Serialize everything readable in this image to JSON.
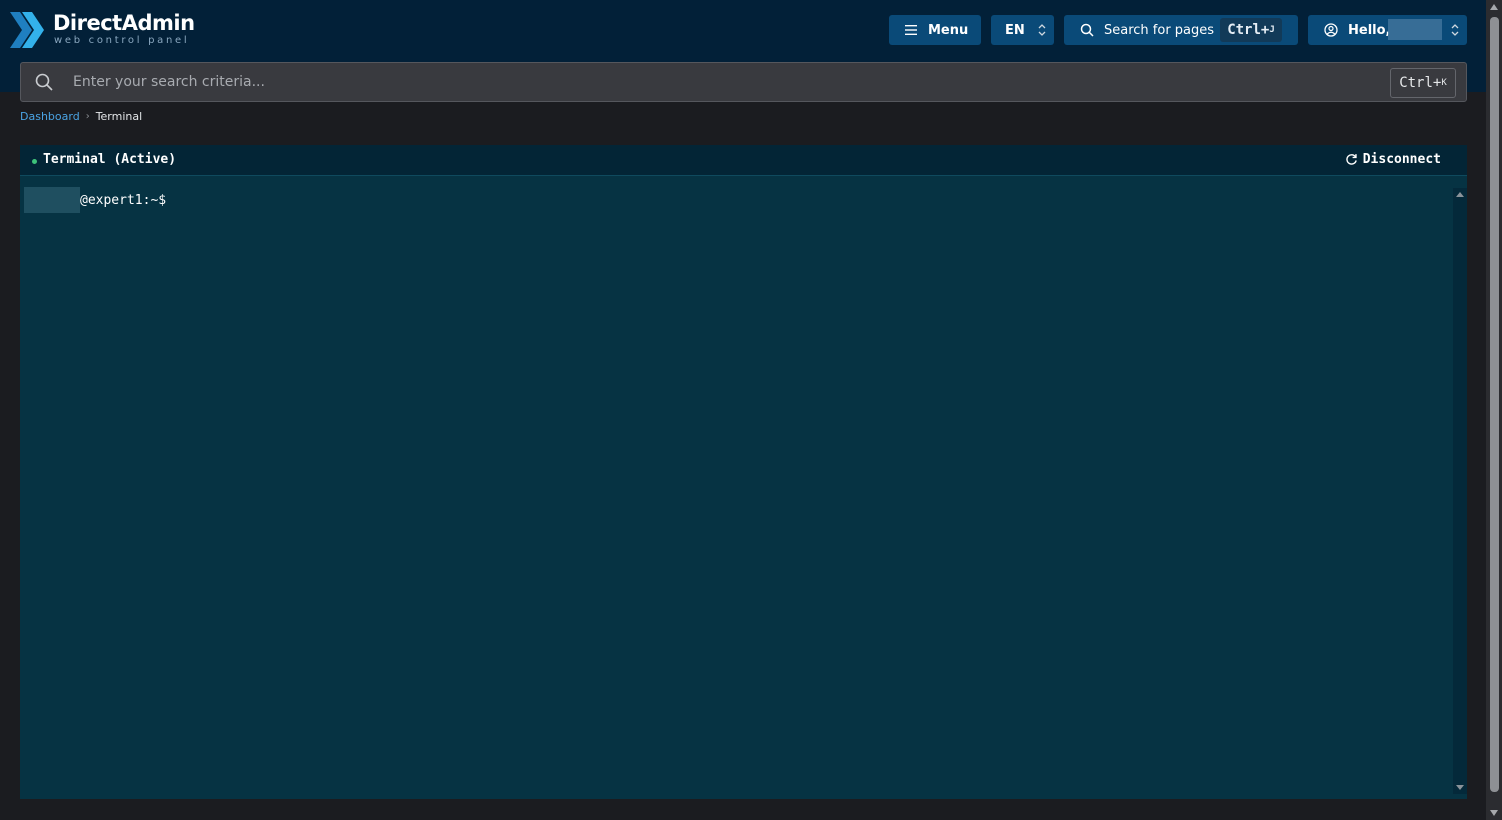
{
  "app": {
    "brand": "DirectAdmin",
    "tagline": "web control panel"
  },
  "header": {
    "menu_label": "Menu",
    "language": "EN",
    "search_pages_label": "Search for pages",
    "search_pages_shortcut": {
      "prefix": "Ctrl+",
      "key": "J"
    },
    "user_greeting": "Hello,"
  },
  "search": {
    "placeholder": "Enter your search criteria...",
    "shortcut": {
      "prefix": "Ctrl+",
      "key": "K"
    }
  },
  "breadcrumb": {
    "root": "Dashboard",
    "current": "Terminal"
  },
  "terminal": {
    "title": "Terminal (Active)",
    "disconnect_label": "Disconnect",
    "prompt_suffix": "@expert1:~$"
  },
  "icons": {
    "menu": "hamburger-icon",
    "language_caret": "updown-caret-icon",
    "search": "search-icon",
    "user": "user-circle-icon",
    "refresh": "refresh-icon"
  },
  "colors": {
    "header_bg": "#022038",
    "button_bg": "#0a4a78",
    "accent": "#29a8e0",
    "terminal_bg": "#063343",
    "status_active": "#3ec27a",
    "link": "#4aa3e3"
  }
}
